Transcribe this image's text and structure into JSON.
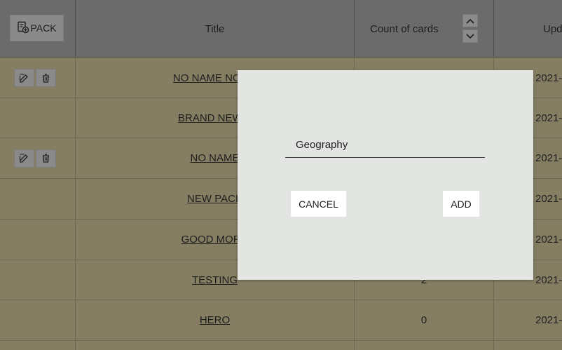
{
  "header": {
    "pack_button_label": "PACK",
    "columns": [
      "Title",
      "Count of cards",
      "Upd"
    ]
  },
  "rows": [
    {
      "title": "NO NAME NONO",
      "count": "",
      "updated": "2021-",
      "has_actions": true
    },
    {
      "title": "BRAND NEW F",
      "count": "",
      "updated": "2021-",
      "has_actions": false
    },
    {
      "title": "NO NAME",
      "count": "",
      "updated": "2021-",
      "has_actions": true
    },
    {
      "title": "NEW PACK",
      "count": "",
      "updated": "2021-",
      "has_actions": false
    },
    {
      "title": "GOOD MORN",
      "count": "",
      "updated": "2021-",
      "has_actions": false
    },
    {
      "title": "TESTING",
      "count": "2",
      "updated": "2021-",
      "has_actions": false
    },
    {
      "title": "HERO",
      "count": "0",
      "updated": "2021-",
      "has_actions": false
    }
  ],
  "modal": {
    "input_value": "Geography",
    "cancel_label": "CANCEL",
    "add_label": "ADD"
  },
  "icons": {
    "pack": "add-pack-icon",
    "sort_up": "chevron-up-icon",
    "sort_down": "chevron-down-icon",
    "edit": "edit-icon",
    "delete": "trash-icon"
  },
  "colors": {
    "header_bg": "#6b6b6b",
    "body_bg": "#857e63",
    "modal_bg": "#e3e5e3",
    "button_bg": "#ffffff"
  }
}
